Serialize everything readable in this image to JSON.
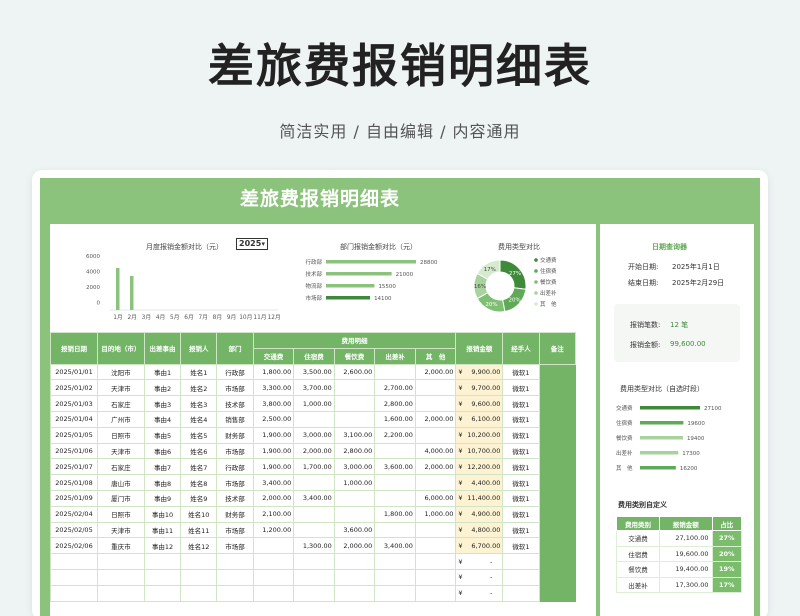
{
  "banner": {
    "title": "差旅费报销明细表",
    "subtitle": "简洁实用 / 自由编辑 / 内容通用"
  },
  "sheet": {
    "title": "差旅费报销明细表"
  },
  "monthly_chart": {
    "title": "月度报销金额对比（元）",
    "year": "2025",
    "y_ticks": [
      "6000",
      "4000",
      "2000",
      "0"
    ],
    "months": [
      "1月",
      "2月",
      "3月",
      "4月",
      "5月",
      "6月",
      "7月",
      "8月",
      "9月",
      "10月",
      "11月",
      "12月"
    ],
    "bar_color": "#8cc37c"
  },
  "dept_chart": {
    "title": "部门报销金额对比（元）",
    "items": [
      {
        "name": "行政部",
        "value": "28800"
      },
      {
        "name": "技术部",
        "value": "21000"
      },
      {
        "name": "物流部",
        "value": "15500"
      },
      {
        "name": "市场部",
        "value": "14100"
      }
    ]
  },
  "type_chart": {
    "title": "费用类型对比",
    "legend": [
      "交通费",
      "住宿费",
      "餐饮费",
      "出差补",
      "其　他"
    ],
    "labels": [
      "27%",
      "20%",
      "20%",
      "16%",
      "17%"
    ],
    "colors": [
      "#3f8a3a",
      "#5fa957",
      "#7fbf74",
      "#a8d39e",
      "#d6ead0"
    ]
  },
  "table": {
    "headers": [
      "报销日期",
      "目的地（市）",
      "出差事由",
      "报销人",
      "部门",
      "费用明细",
      "报销金额",
      "经手人",
      "备注"
    ],
    "sub_headers": [
      "交通费",
      "住宿费",
      "餐饮费",
      "出差补",
      "其　他"
    ],
    "rows": [
      [
        "2025/01/01",
        "沈阳市",
        "事由1",
        "姓名1",
        "行政部",
        "1,800.00",
        "3,500.00",
        "2,600.00",
        "",
        "2,000.00",
        "9,900.00",
        "微软1"
      ],
      [
        "2025/01/02",
        "天津市",
        "事由2",
        "姓名2",
        "市场部",
        "3,300.00",
        "3,700.00",
        "",
        "2,700.00",
        "",
        "9,700.00",
        "微软1"
      ],
      [
        "2025/01/03",
        "石家庄",
        "事由3",
        "姓名3",
        "技术部",
        "3,800.00",
        "1,000.00",
        "",
        "2,800.00",
        "",
        "9,600.00",
        "微软1"
      ],
      [
        "2025/01/04",
        "广州市",
        "事由4",
        "姓名4",
        "销售部",
        "2,500.00",
        "",
        "",
        "1,600.00",
        "2,000.00",
        "6,100.00",
        "微软1"
      ],
      [
        "2025/01/05",
        "日照市",
        "事由5",
        "姓名5",
        "财务部",
        "1,900.00",
        "3,000.00",
        "3,100.00",
        "2,200.00",
        "",
        "10,200.00",
        "微软1"
      ],
      [
        "2025/01/06",
        "天津市",
        "事由6",
        "姓名6",
        "市场部",
        "1,900.00",
        "2,000.00",
        "2,800.00",
        "",
        "4,000.00",
        "10,700.00",
        "微软1"
      ],
      [
        "2025/01/07",
        "石家庄",
        "事由7",
        "姓名7",
        "行政部",
        "1,900.00",
        "1,700.00",
        "3,000.00",
        "3,600.00",
        "2,000.00",
        "12,200.00",
        "微软1"
      ],
      [
        "2025/01/08",
        "唐山市",
        "事由8",
        "姓名8",
        "市场部",
        "3,400.00",
        "",
        "1,000.00",
        "",
        "",
        "4,400.00",
        "微软1"
      ],
      [
        "2025/01/09",
        "厦门市",
        "事由9",
        "姓名9",
        "技术部",
        "2,000.00",
        "3,400.00",
        "",
        "",
        "6,000.00",
        "11,400.00",
        "微软1"
      ],
      [
        "2025/02/04",
        "日照市",
        "事由10",
        "姓名10",
        "财务部",
        "2,100.00",
        "",
        "",
        "1,800.00",
        "1,000.00",
        "4,900.00",
        "微软1"
      ],
      [
        "2025/02/05",
        "天津市",
        "事由11",
        "姓名11",
        "市场部",
        "1,200.00",
        "",
        "3,600.00",
        "",
        "",
        "4,800.00",
        "微软1"
      ],
      [
        "2025/02/06",
        "重庆市",
        "事由12",
        "姓名12",
        "市场部",
        "",
        "1,300.00",
        "2,000.00",
        "3,400.00",
        "",
        "6,700.00",
        "微软1"
      ]
    ],
    "currency": "¥",
    "dash": "-"
  },
  "side": {
    "query_title": "日期查询器",
    "start_label": "开始日期:",
    "start_value": "2025年1月1日",
    "end_label": "结束日期:",
    "end_value": "2025年2月29日",
    "count_label": "报销笔数:",
    "count_value": "12 笔",
    "amount_label": "报销金额:",
    "amount_value": "99,600.00",
    "type_title": "费用类型对比（自选时段）",
    "type_items": [
      {
        "name": "交通费",
        "value": "27100"
      },
      {
        "name": "住宿费",
        "value": "19600"
      },
      {
        "name": "餐饮费",
        "value": "19400"
      },
      {
        "name": "出差补",
        "value": "17300"
      },
      {
        "name": "其　他",
        "value": "16200"
      }
    ],
    "def_title": "费用类别自定义",
    "def_headers": [
      "费用类别",
      "报销金额",
      "占比"
    ],
    "def_rows": [
      [
        "交通费",
        "27,100.00",
        "27%"
      ],
      [
        "住宿费",
        "19,600.00",
        "20%"
      ],
      [
        "餐饮费",
        "19,400.00",
        "19%"
      ],
      [
        "出差补",
        "17,300.00",
        "17%"
      ]
    ]
  }
}
